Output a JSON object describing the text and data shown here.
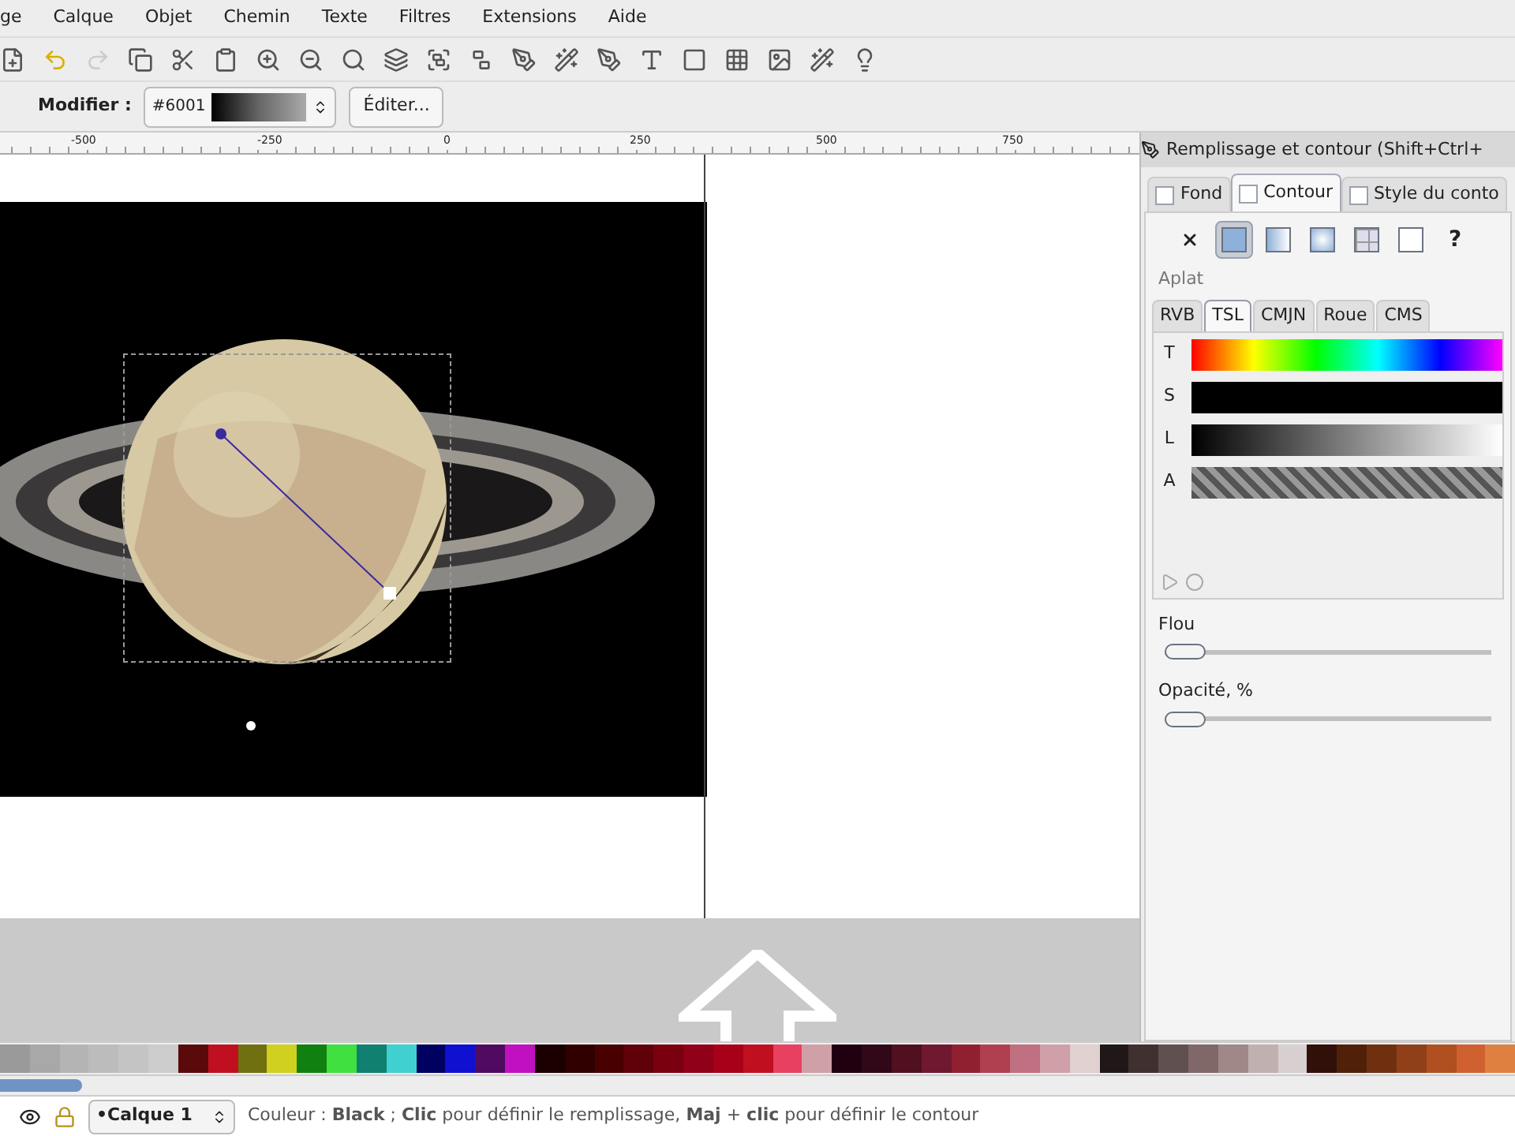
{
  "menu": [
    "ge",
    "Calque",
    "Objet",
    "Chemin",
    "Texte",
    "Filtres",
    "Extensions",
    "Aide"
  ],
  "tool_controls": {
    "label": "Modifier :",
    "gradient": "#6001",
    "edit_button": "Éditer..."
  },
  "ruler": [
    "-500",
    "-250",
    "0",
    "250",
    "500",
    "750"
  ],
  "panel": {
    "title": "Remplissage et contour (Shift+Ctrl+",
    "tabs": [
      {
        "label": "Fond",
        "selected": false
      },
      {
        "label": "Contour",
        "selected": true
      },
      {
        "label": "Style du conto",
        "selected": false
      }
    ],
    "paint_types": [
      {
        "kind": "none",
        "selected": false
      },
      {
        "kind": "flat",
        "selected": true
      },
      {
        "kind": "linear",
        "selected": false
      },
      {
        "kind": "radial",
        "selected": false
      },
      {
        "kind": "pattern",
        "selected": false
      },
      {
        "kind": "swatch",
        "selected": false
      },
      {
        "kind": "unset",
        "label": "?",
        "selected": false
      }
    ],
    "paint_label": "Aplat",
    "color_tabs": [
      {
        "label": "RVB",
        "selected": false
      },
      {
        "label": "TSL",
        "selected": true
      },
      {
        "label": "CMJN",
        "selected": false
      },
      {
        "label": "Roue",
        "selected": false
      },
      {
        "label": "CMS",
        "selected": false
      }
    ],
    "channels": [
      {
        "label": "T",
        "kind": "hue"
      },
      {
        "label": "S",
        "kind": "saturation"
      },
      {
        "label": "L",
        "kind": "lightness"
      },
      {
        "label": "A",
        "kind": "alpha"
      }
    ],
    "blur": {
      "label": "Flou",
      "level": 0
    },
    "opacity": {
      "label": "Opacité, %",
      "level": 0
    }
  },
  "palette": [
    {
      "color": "#9a9a9a"
    },
    {
      "color": "#a8a8a8"
    },
    {
      "color": "#b4b4b4"
    },
    {
      "color": "#bcbcbc"
    },
    {
      "color": "#c4c4c4"
    },
    {
      "color": "#cccccc"
    },
    {
      "color": "#5a0a0a"
    },
    {
      "color": "#c01020"
    },
    {
      "color": "#707010"
    },
    {
      "color": "#d0d020"
    },
    {
      "color": "#108010"
    },
    {
      "color": "#40e040"
    },
    {
      "color": "#108070"
    },
    {
      "color": "#40d0d0"
    },
    {
      "color": "#000060"
    },
    {
      "color": "#1010d0"
    },
    {
      "color": "#500a60"
    },
    {
      "color": "#c010c0"
    },
    {
      "color": "#1a0000"
    },
    {
      "color": "#300000"
    },
    {
      "color": "#480000"
    },
    {
      "color": "#600008"
    },
    {
      "color": "#7a0010"
    },
    {
      "color": "#900018"
    },
    {
      "color": "#a80018"
    },
    {
      "color": "#c01020"
    },
    {
      "color": "#e84060"
    },
    {
      "color": "#d0a0a8"
    },
    {
      "color": "#200010"
    },
    {
      "color": "#300818"
    },
    {
      "color": "#501020"
    },
    {
      "color": "#701830"
    },
    {
      "color": "#902030"
    },
    {
      "color": "#b04050"
    },
    {
      "color": "#c07080"
    },
    {
      "color": "#d0a0a8"
    },
    {
      "color": "#e0d0d0"
    },
    {
      "color": "#201818"
    },
    {
      "color": "#403030"
    },
    {
      "color": "#605050"
    },
    {
      "color": "#806868"
    },
    {
      "color": "#a08888"
    },
    {
      "color": "#c0b0b0"
    },
    {
      "color": "#d8d0d0"
    },
    {
      "color": "#301008"
    },
    {
      "color": "#502008"
    },
    {
      "color": "#703010"
    },
    {
      "color": "#904018"
    },
    {
      "color": "#b05020"
    },
    {
      "color": "#d06030"
    },
    {
      "color": "#e08040"
    }
  ],
  "status": {
    "layer": "•Calque 1",
    "message": "Couleur : **Black** ; **Clic** pour définir le remplissage, **Maj** + **clic** pour définir le contour"
  }
}
